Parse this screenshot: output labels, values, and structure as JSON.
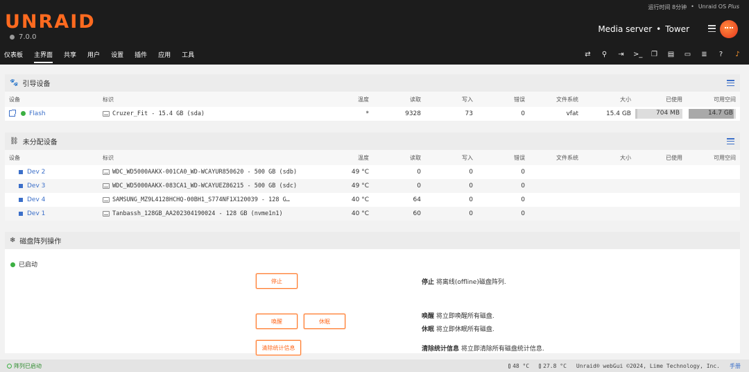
{
  "header": {
    "logo": "UNRAID",
    "version": "7.0.0",
    "uptime": "运行时间 8分钟",
    "separator": "•",
    "edition": "Unraid OS",
    "edition_plus": "Plus",
    "server_desc": "Media server",
    "server_sep": "•",
    "server_name": "Tower"
  },
  "nav": [
    "仪表板",
    "主界面",
    "共享",
    "用户",
    "设置",
    "插件",
    "应用",
    "工具"
  ],
  "tool_icons": [
    "switch-icon",
    "search-icon",
    "logout-icon",
    "terminal-icon",
    "copy-icon",
    "log-icon",
    "display-icon",
    "feedback-icon",
    "help-icon",
    "bell-icon"
  ],
  "columns": {
    "device": "设备",
    "ident": "标识",
    "temp": "温度",
    "reads": "读取",
    "writes": "写入",
    "errors": "错误",
    "fs": "文件系统",
    "size": "大小",
    "used": "已使用",
    "free": "可用空间"
  },
  "boot": {
    "title": "引导设备",
    "rows": [
      {
        "device": "Flash",
        "ident": "Cruzer_Fit - 15.4 GB (sda)",
        "temp": "*",
        "reads": "9328",
        "writes": "73",
        "errors": "0",
        "fs": "vfat",
        "size": "15.4 GB",
        "used": "704 MB",
        "free": "14.7 GB",
        "used_frac": 0.045,
        "free_frac": 0.955
      }
    ]
  },
  "unassigned": {
    "title": "未分配设备",
    "rows": [
      {
        "device": "Dev 2",
        "ident": "WDC_WD5000AAKX-001CA0_WD-WCAYUR850620 - 500 GB (sdb)",
        "temp": "49 °C",
        "reads": "0",
        "writes": "0",
        "errors": "0"
      },
      {
        "device": "Dev 3",
        "ident": "WDC_WD5000AAKX-083CA1_WD-WCAYUEZ86215 - 500 GB (sdc)",
        "temp": "49 °C",
        "reads": "0",
        "writes": "0",
        "errors": "0"
      },
      {
        "device": "Dev 4",
        "ident": "SAMSUNG_MZ9L4128HCHQ-00BH1_S774NF1X120039 - 128 G…",
        "temp": "40 °C",
        "reads": "64",
        "writes": "0",
        "errors": "0"
      },
      {
        "device": "Dev 1",
        "ident": "Tanbassh_128GB_AA202304190024 - 128 GB (nvme1n1)",
        "temp": "40 °C",
        "reads": "60",
        "writes": "0",
        "errors": "0"
      }
    ]
  },
  "array": {
    "title": "磁盘阵列操作",
    "status": "已启动",
    "stop_btn": "停止",
    "stop_bold": "停止",
    "stop_desc": " 将离线(offline)磁盘阵列.",
    "spinup_btn": "唤醒",
    "spindown_btn": "休眠",
    "spinup_bold": "唤醒",
    "spinup_desc": " 将立即唤醒所有磁盘.",
    "spindown_bold": "休眠",
    "spindown_desc": " 将立即休眠所有磁盘.",
    "clear_btn": "清除统计信息",
    "clear_bold": "清除统计信息",
    "clear_desc": " 将立即清除所有磁盘统计信息."
  },
  "footer": {
    "status": "阵列已启动",
    "temp1": "48 °C",
    "temp2": "27.8 °C",
    "copyright": "Unraid® webGui ©2024, Lime Technology, Inc.",
    "manual": "手册"
  }
}
